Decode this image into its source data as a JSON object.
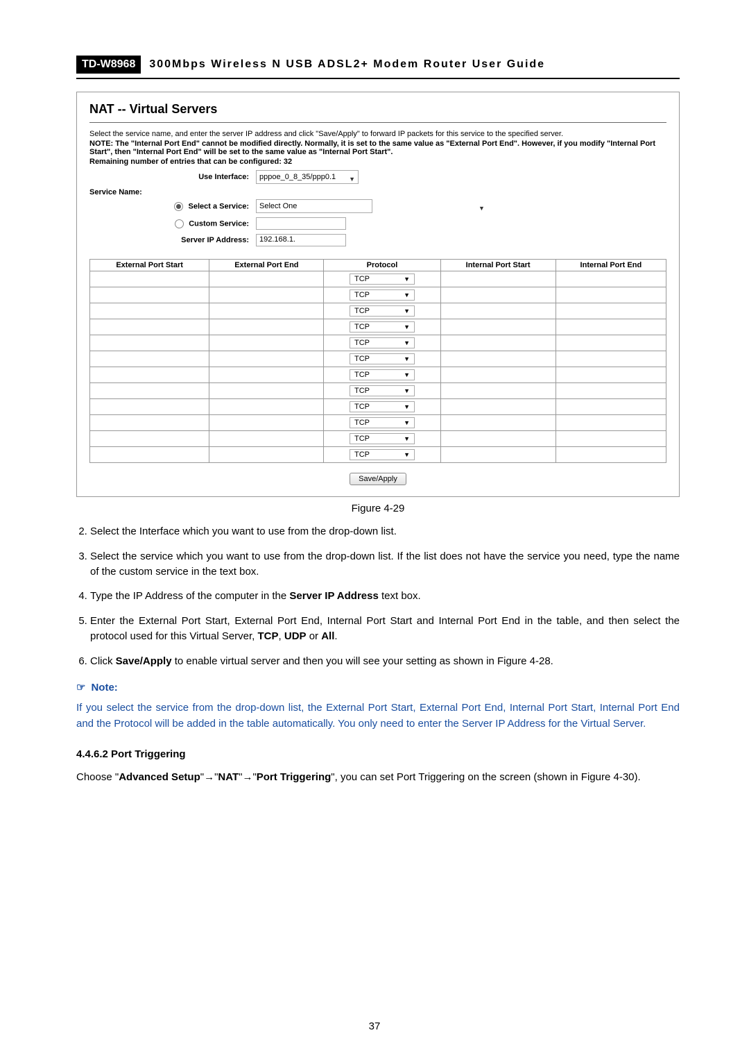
{
  "header": {
    "model": "TD-W8968",
    "title": "300Mbps Wireless N USB ADSL2+ Modem Router User Guide"
  },
  "screenshot": {
    "title": "NAT -- Virtual Servers",
    "description": "Select the service name, and enter the server IP address and click \"Save/Apply\" to forward IP packets for this service to the specified server.",
    "note": "NOTE: The \"Internal Port End\" cannot be modified directly. Normally, it is set to the same value as \"External Port End\". However, if you modify \"Internal Port Start\", then \"Internal Port End\" will be set to the same value as \"Internal Port Start\".",
    "remaining": "Remaining number of entries that can be configured: 32",
    "use_interface_label": "Use Interface:",
    "use_interface_value": "pppoe_0_8_35/ppp0.1",
    "service_name_label": "Service Name:",
    "select_service_label": "Select a Service:",
    "select_service_value": "Select One",
    "custom_service_label": "Custom Service:",
    "server_ip_label": "Server IP Address:",
    "server_ip_value": "192.168.1.",
    "columns": {
      "ext_start": "External Port Start",
      "ext_end": "External Port End",
      "protocol": "Protocol",
      "int_start": "Internal Port Start",
      "int_end": "Internal Port End"
    },
    "protocol_value": "TCP",
    "save_apply": "Save/Apply"
  },
  "figure_caption": "Figure 4-29",
  "instructions": {
    "i2": "Select the Interface which you want to use from the drop-down list.",
    "i3": "Select the service which you want to use from the drop-down list. If the list does not have the service you need, type the name of the custom service in the text box.",
    "i4_p1": "Type the IP Address of the computer in the ",
    "i4_b": "Server IP Address",
    "i4_p2": " text box.",
    "i5_p1": "Enter the External Port Start, External Port End, Internal Port Start and Internal Port End in the table, and then select the protocol used for this Virtual Server, ",
    "i5_b1": "TCP",
    "i5_m1": ", ",
    "i5_b2": "UDP",
    "i5_m2": " or ",
    "i5_b3": "All",
    "i5_p2": ".",
    "i6_p1": "Click ",
    "i6_b": "Save/Apply",
    "i6_p2": " to enable virtual server and then you will see your setting as shown in Figure 4-28."
  },
  "note_section": {
    "heading": "Note:",
    "body": "If you select the service from the drop-down list, the External Port Start, External Port End, Internal Port Start, Internal Port End and the Protocol will be added in the table automatically. You only need to enter the Server IP Address for the Virtual Server."
  },
  "section": {
    "heading": "4.4.6.2   Port Triggering",
    "body_p1": "Choose \"",
    "body_b1": "Advanced Setup",
    "body_m1": "\"",
    "arrow": "→",
    "body_m2": "\"",
    "body_b2": "NAT",
    "body_m3": "\"",
    "body_m4": "\"",
    "body_b3": "Port Triggering",
    "body_m5": "\", you can set Port Triggering on the screen (shown in Figure 4-30)."
  },
  "page_number": "37"
}
